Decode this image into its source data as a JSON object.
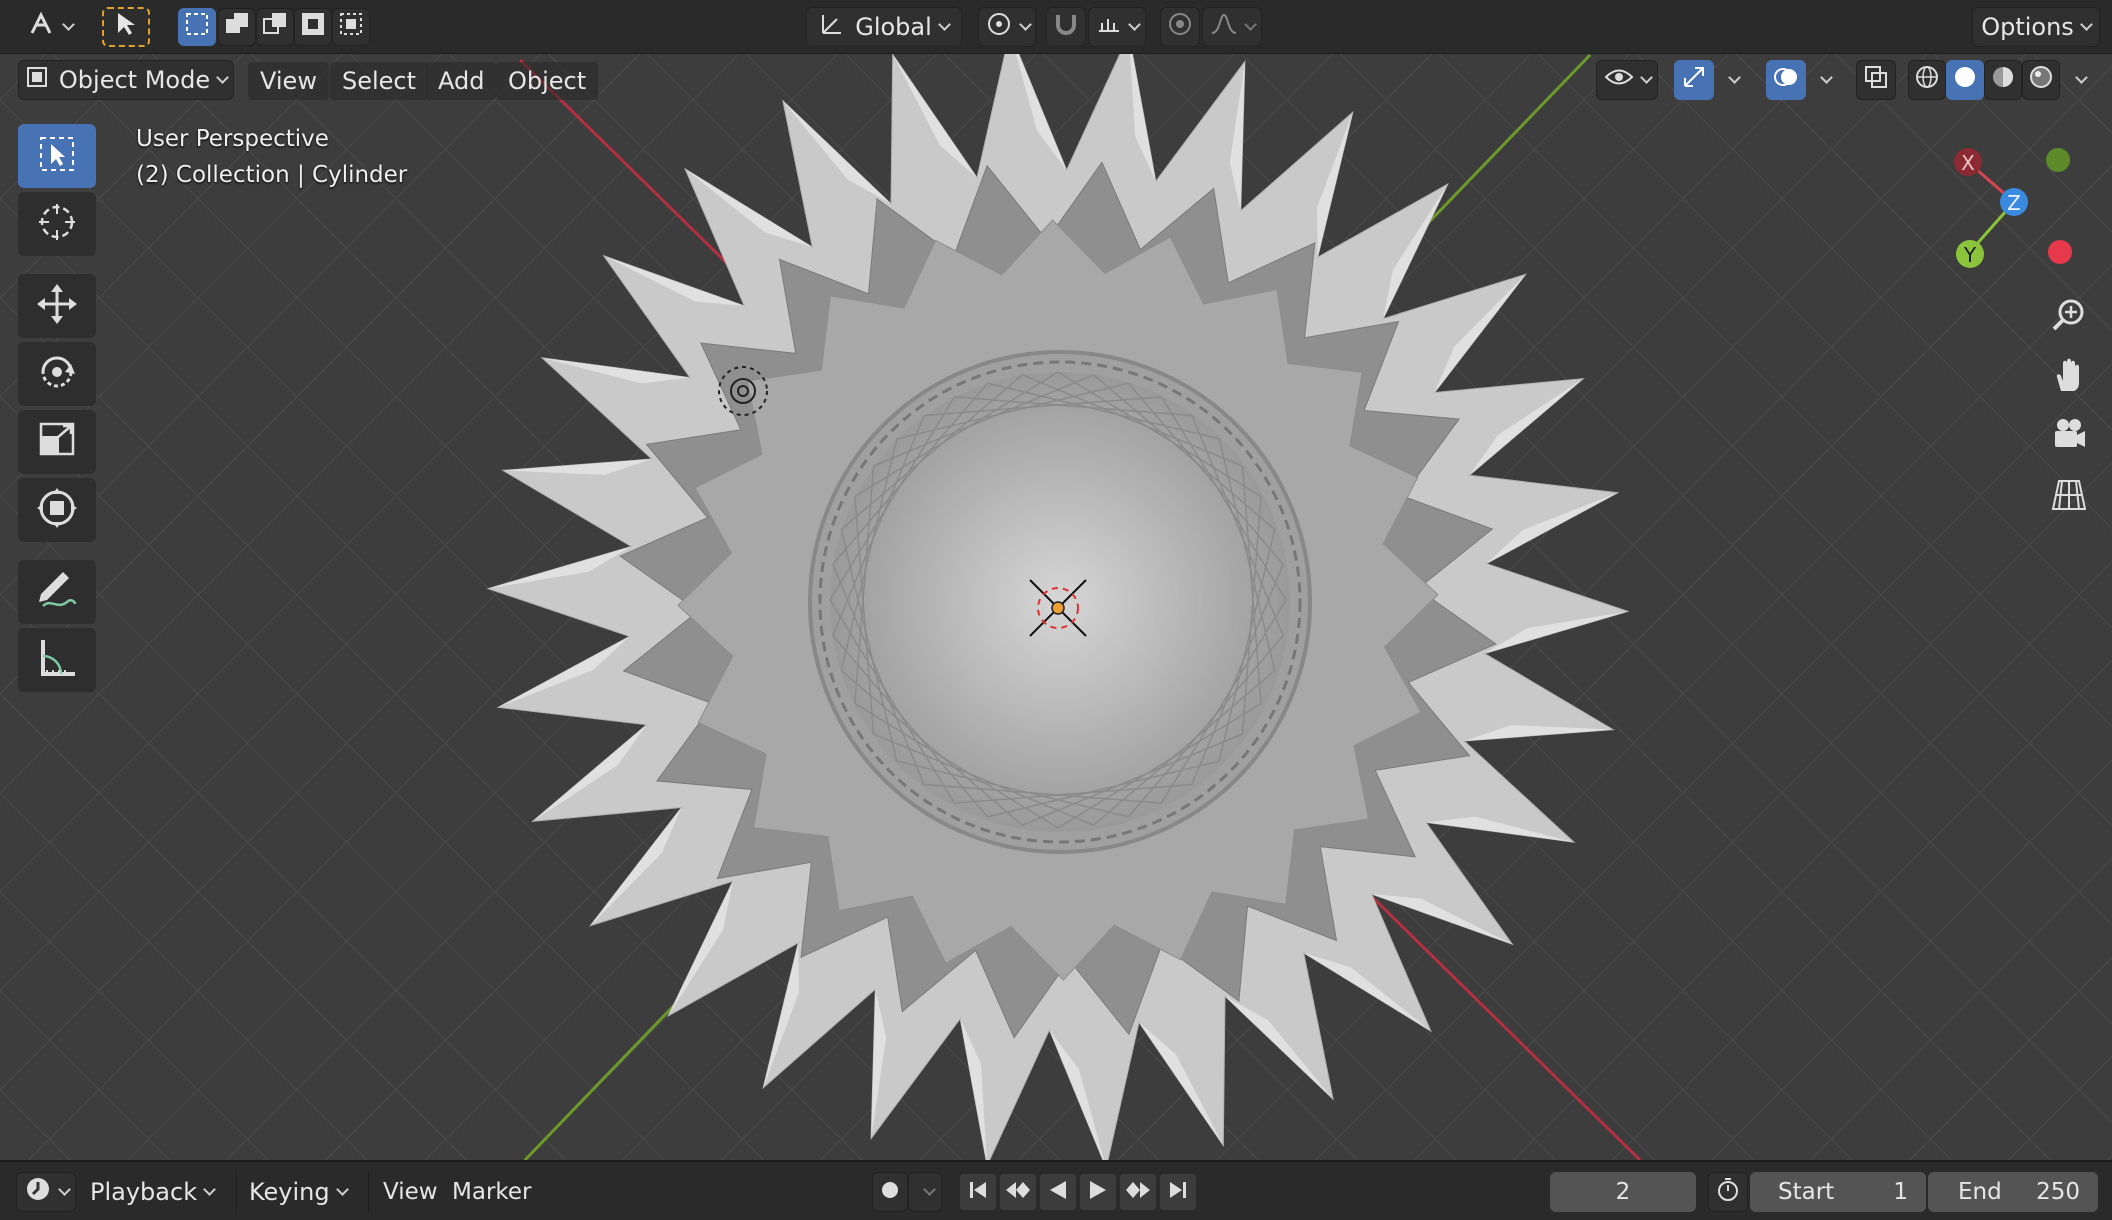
{
  "header": {
    "orientation": "Global",
    "options_label": "Options"
  },
  "menu": {
    "mode": "Object Mode",
    "view": "View",
    "select": "Select",
    "add": "Add",
    "object": "Object"
  },
  "overlay": {
    "perspective": "User Perspective",
    "collection": "(2) Collection | Cylinder"
  },
  "gizmo": {
    "x_label": "X",
    "y_label": "Y",
    "z_label": "Z",
    "x_color": "#d94452",
    "y_color": "#8bc43a",
    "z_color": "#3a8ae0"
  },
  "timeline": {
    "playback": "Playback",
    "keying": "Keying",
    "view": "View",
    "marker": "Marker",
    "current_frame": "2",
    "start_label": "Start",
    "start_value": "1",
    "end_label": "End",
    "end_value": "250"
  },
  "colors": {
    "accent": "#4772b3",
    "background": "#3d3d3d",
    "axis_x": "#b2303f",
    "axis_y": "#6b9a2a"
  }
}
